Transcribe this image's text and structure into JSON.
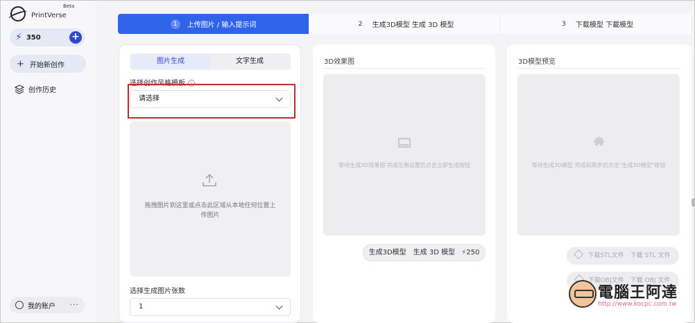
{
  "app": {
    "name": "PrintVerse",
    "badge": "Beta"
  },
  "sidebar": {
    "credits": "350",
    "new_label": "开始新创作",
    "history_label": "创作历史",
    "account_label": "我的账户",
    "more": "···"
  },
  "steps": [
    {
      "num": "1",
      "label": "上传图片 / 输入提示词"
    },
    {
      "num": "2",
      "label": "生成3D模型 生成 3D 模型"
    },
    {
      "num": "3",
      "label": "下载模型 下載模型"
    }
  ],
  "left_panel": {
    "tabs": [
      "图片生成",
      "文字生成"
    ],
    "style_label": "选择创作风格模板",
    "style_value": "请选择",
    "upload_text": "拖拽图片到这里或点击此区域从本地任何位置上传图片",
    "count_label": "选择生成图片张数",
    "count_value": "1"
  },
  "mid_panel": {
    "title": "3D效果图",
    "placeholder_text": "等待生成3D效果图 完成左侧设置后点击立即生成按钮",
    "generate_label": "生成3D模型　生成 3D 模型",
    "cost": "250"
  },
  "right_panel": {
    "title": "3D模型预览",
    "placeholder_text": "等待生成3D模型 完成前两步后点击\"生成3D模型\"按钮",
    "download_stl": "下载STL文件　下載 STL 文件",
    "download_obj": "下载OBJ文件　下載 OBJ 文件"
  },
  "watermark": {
    "title": "電腦王阿達",
    "url": "http://www.kocpc.com.tw"
  },
  "colors": {
    "accent": "#2f63ea",
    "brand_blue": "#2f49d1",
    "highlight": "#c0302f"
  }
}
